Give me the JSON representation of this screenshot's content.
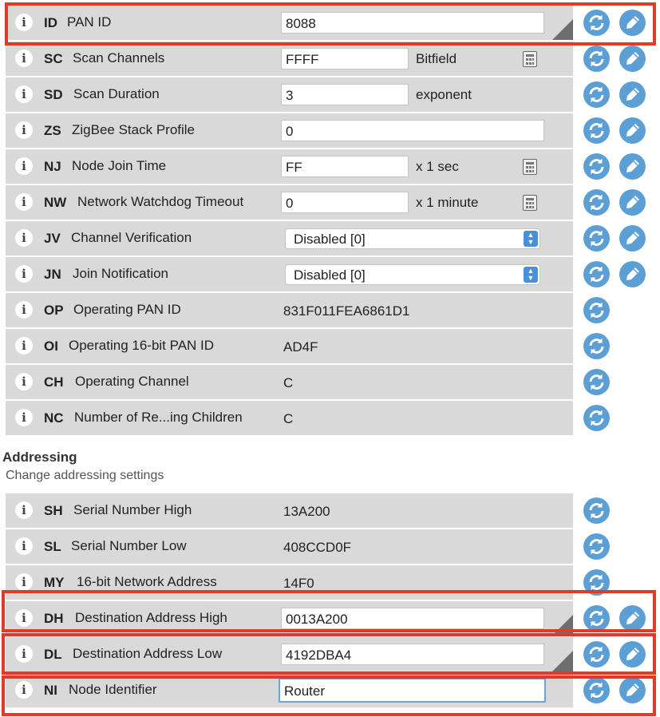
{
  "network": {
    "rows": [
      {
        "code": "ID",
        "label": "PAN ID",
        "value": "8088"
      },
      {
        "code": "SC",
        "label": "Scan Channels",
        "value": "FFFF",
        "suffix": "Bitfield"
      },
      {
        "code": "SD",
        "label": "Scan Duration",
        "value": "3",
        "suffix": "exponent"
      },
      {
        "code": "ZS",
        "label": "ZigBee Stack Profile",
        "value": "0"
      },
      {
        "code": "NJ",
        "label": "Node Join Time",
        "value": "FF",
        "suffix": "x 1 sec"
      },
      {
        "code": "NW",
        "label": "Network Watchdog Timeout",
        "value": "0",
        "suffix": "x 1 minute"
      },
      {
        "code": "JV",
        "label": "Channel Verification",
        "value": "Disabled [0]"
      },
      {
        "code": "JN",
        "label": "Join Notification",
        "value": "Disabled [0]"
      },
      {
        "code": "OP",
        "label": "Operating PAN ID",
        "value": "831F011FEA6861D1"
      },
      {
        "code": "OI",
        "label": "Operating 16-bit PAN ID",
        "value": "AD4F"
      },
      {
        "code": "CH",
        "label": "Operating Channel",
        "value": "C"
      },
      {
        "code": "NC",
        "label": "Number of Re...ing Children",
        "value": "C"
      }
    ]
  },
  "addressing": {
    "title": "Addressing",
    "subtitle": "Change addressing settings",
    "rows": [
      {
        "code": "SH",
        "label": "Serial Number High",
        "value": "13A200"
      },
      {
        "code": "SL",
        "label": "Serial Number Low",
        "value": "408CCD0F"
      },
      {
        "code": "MY",
        "label": "16-bit Network Address",
        "value": "14F0"
      },
      {
        "code": "DH",
        "label": "Destination Address High",
        "value": "0013A200"
      },
      {
        "code": "DL",
        "label": "Destination Address Low",
        "value": "4192DBA4"
      },
      {
        "code": "NI",
        "label": "Node Identifier",
        "value": "Router"
      }
    ]
  },
  "info_glyph": "i",
  "icons": {
    "info": "info-icon",
    "read": "refresh-icon",
    "write": "pencil-icon",
    "calculator": "calculator-icon",
    "select_arrows": "updown-arrows-icon"
  },
  "colors": {
    "row_bg": "#d9d9d9",
    "button_blue": "#5b9fd4",
    "highlight_red": "#e03a2a",
    "focus_blue": "#6aa6d6"
  }
}
